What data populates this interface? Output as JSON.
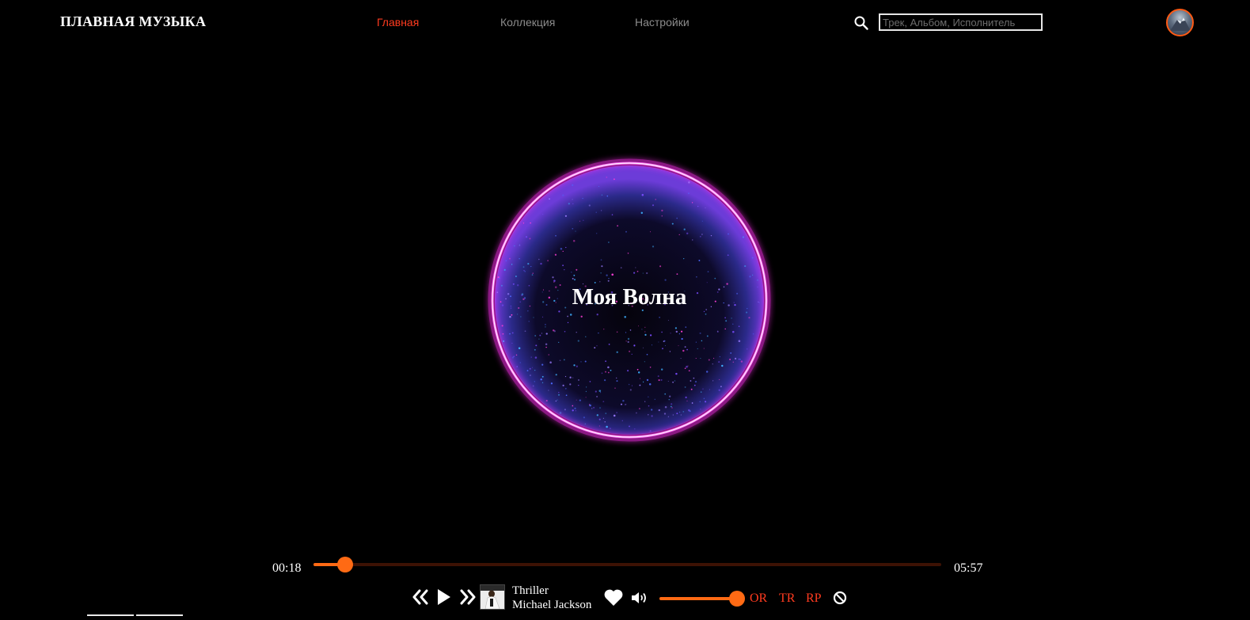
{
  "header": {
    "logo": "ПЛАВНАЯ МУЗЫКА",
    "nav": [
      {
        "label": "Главная",
        "active": true
      },
      {
        "label": "Коллекция",
        "active": false
      },
      {
        "label": "Настройки",
        "active": false
      }
    ],
    "search_placeholder": "Трек, Альбом, Исполнитель",
    "search_icon": "search-icon",
    "avatar_icon": "avatar"
  },
  "main": {
    "wave_title": "Моя Волна"
  },
  "player": {
    "current_time": "00:18",
    "total_time": "05:57",
    "progress_fraction": 0.05,
    "track_title": "Thriller",
    "track_artist": "Michael Jackson",
    "volume_fraction": 1.0,
    "modes": [
      "OR",
      "TR",
      "RP"
    ],
    "icons": [
      "prev-icon",
      "play-icon",
      "next-icon",
      "heart-icon",
      "volume-icon",
      "block-icon"
    ]
  },
  "colors": {
    "accent": "#ff6a14",
    "active_nav": "#ff3b1f",
    "glow": "#ff38f0",
    "background": "#000000"
  }
}
